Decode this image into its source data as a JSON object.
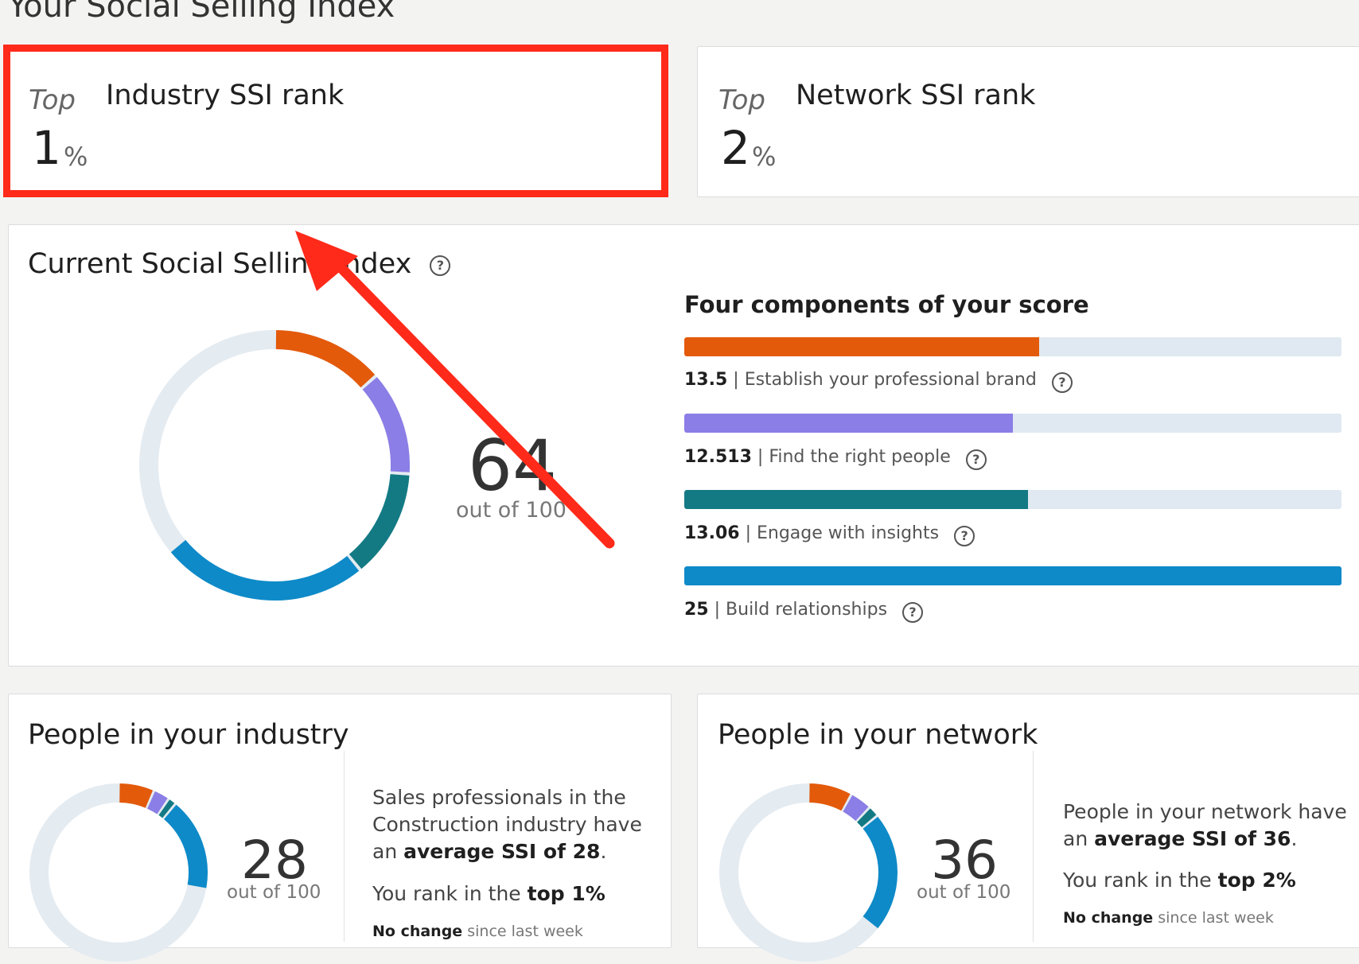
{
  "page": {
    "title": "Your Social Selling Index"
  },
  "industry_rank": {
    "top_label": "Top",
    "label": "Industry SSI rank",
    "value": "1",
    "unit": "%"
  },
  "network_rank": {
    "top_label": "Top",
    "label": "Network SSI rank",
    "value": "2",
    "unit": "%"
  },
  "current_ssi": {
    "title": "Current Social Selling Index",
    "help_icon": "question-circle-icon",
    "score": "64",
    "out_of": "out of 100",
    "components_title": "Four components of your score",
    "max_per_component": 25,
    "components": [
      {
        "value": "13.5",
        "label": "Establish your professional brand",
        "color": "#e35a0b"
      },
      {
        "value": "12.513",
        "label": "Find the right people",
        "color": "#8b7ee6"
      },
      {
        "value": "13.06",
        "label": "Engage with insights",
        "color": "#137a84"
      },
      {
        "value": "25",
        "label": "Build relationships",
        "color": "#0e8ac8"
      }
    ]
  },
  "industry": {
    "title": "People in your industry",
    "score": "28",
    "out_of": "out of 100",
    "desc_pre": "Sales professionals in the Construction industry have an ",
    "desc_bold": "average SSI of 28",
    "desc_post": ".",
    "rank_pre": "You rank in the ",
    "rank_bold": "top 1%",
    "change_bold": "No change",
    "change_rest": " since last week",
    "components": [
      6.5,
      3,
      1.5,
      17
    ]
  },
  "network": {
    "title": "People in your network",
    "score": "36",
    "out_of": "out of 100",
    "desc_pre": "People in your network have an ",
    "desc_bold": "average SSI of 36",
    "desc_post": ".",
    "rank_pre": "You rank in the ",
    "rank_bold": "top 2%",
    "change_bold": "No change",
    "change_rest": " since last week",
    "components": [
      8,
      4,
      2,
      22
    ]
  },
  "annotation": {
    "highlight_color": "#ff2a1a",
    "arrow_color": "#ff2a1a"
  }
}
